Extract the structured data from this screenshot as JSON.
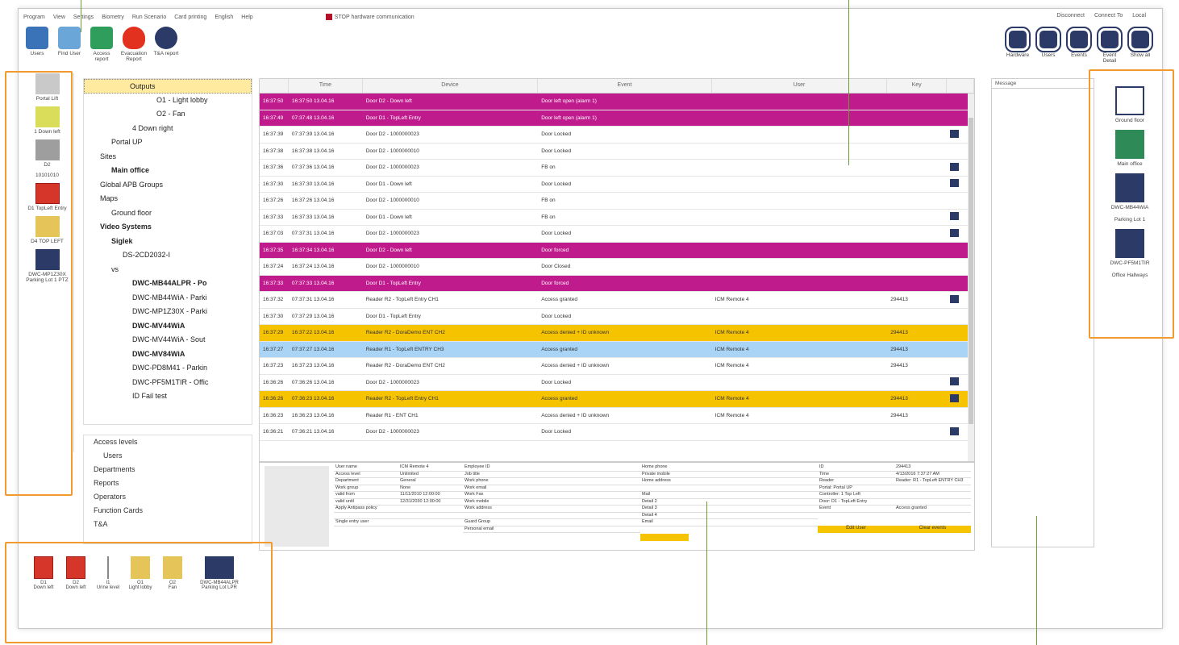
{
  "menu": [
    "Program",
    "View",
    "Settings",
    "Biometry",
    "Run Scenario",
    "Card printing",
    "English",
    "Help"
  ],
  "stop_label": "STOP hardware communication",
  "menu_right": [
    "Disconnect",
    "Connect To",
    "Local"
  ],
  "toolbar": [
    {
      "label": "Users"
    },
    {
      "label": "Find User"
    },
    {
      "label": "Access report"
    },
    {
      "label": "Evacuation Report"
    },
    {
      "label": "T&A report"
    }
  ],
  "toolbar_right": [
    {
      "label": "Hardware"
    },
    {
      "label": "Users"
    },
    {
      "label": "Events"
    },
    {
      "label": "Event Detail"
    },
    {
      "label": "Show all"
    }
  ],
  "left_items": [
    {
      "label": "Portal Lift"
    },
    {
      "label": "1 Down left"
    },
    {
      "label": "D2"
    },
    {
      "label": "10101010"
    },
    {
      "label": "D1 TopLeft Entry"
    },
    {
      "label": "D4 TOP LEFT"
    },
    {
      "label": "DWC-MP1Z30X Parking Lot 1 PTZ"
    }
  ],
  "tree": [
    "Outputs",
    "O1 - Light lobby",
    "O2 - Fan",
    "4 Down right",
    "Portal UP",
    "Sites",
    "Main office",
    "Global APB Groups",
    "Maps",
    "Ground floor",
    "Video Systems",
    "Siglek",
    "DS-2CD2032-I",
    "vs",
    "DWC-MB44ALPR - Po",
    "DWC-MB44WiA - Parki",
    "DWC-MP1Z30X - Parki",
    "DWC-MV44WiA",
    "DWC-MV44WiA - Sout",
    "DWC-MV84WiA",
    "DWC-PD8M41 - Parkin",
    "DWC-PF5M1TIR - Offic",
    "ID Fail test"
  ],
  "tree2": [
    "Access levels",
    "Users",
    "Departments",
    "Reports",
    "Operators",
    "Function Cards",
    "T&A"
  ],
  "grid_headers": [
    "",
    "Time",
    "Device",
    "Event",
    "User",
    "Key",
    ""
  ],
  "rows": [
    {
      "c": "mag",
      "t": "16:37:50",
      "d": "16:37:50 13.04.16",
      "dev": "Door D2 - Down left",
      "ev": "Door left open (alarm 1)",
      "u": "",
      "k": "",
      "cam": false
    },
    {
      "c": "mag",
      "t": "16:37:49",
      "d": "07:37:48 13.04.16",
      "dev": "Door D1 - TopLeft Entry",
      "ev": "Door left open (alarm 1)",
      "u": "",
      "k": "",
      "cam": false
    },
    {
      "c": "",
      "t": "16:37:39",
      "d": "07:37:39 13.04.16",
      "dev": "Door D2 - 1000000023",
      "ev": "Door Locked",
      "u": "",
      "k": "",
      "cam": true
    },
    {
      "c": "",
      "t": "16:37:38",
      "d": "16:37:38 13.04.16",
      "dev": "Door D2 - 1000000010",
      "ev": "Door Locked",
      "u": "",
      "k": "",
      "cam": false
    },
    {
      "c": "",
      "t": "16:37:36",
      "d": "07:37:36 13.04.16",
      "dev": "Door D2 - 1000000023",
      "ev": "FB on",
      "u": "",
      "k": "",
      "cam": true
    },
    {
      "c": "",
      "t": "16:37:30",
      "d": "16:37:30 13.04.16",
      "dev": "Door D1 - Down left",
      "ev": "Door Locked",
      "u": "",
      "k": "",
      "cam": true
    },
    {
      "c": "",
      "t": "16:37:26",
      "d": "16:37:26 13.04.16",
      "dev": "Door D2 - 1000000010",
      "ev": "FB on",
      "u": "",
      "k": "",
      "cam": false
    },
    {
      "c": "",
      "t": "16:37:33",
      "d": "16:37:33 13.04.16",
      "dev": "Door D1 - Down left",
      "ev": "FB on",
      "u": "",
      "k": "",
      "cam": true
    },
    {
      "c": "",
      "t": "16:37:03",
      "d": "07:37:31 13.04.16",
      "dev": "Door D2 - 1000000023",
      "ev": "Door Locked",
      "u": "",
      "k": "",
      "cam": true
    },
    {
      "c": "mag",
      "t": "16:37:35",
      "d": "16:37:34 13.04.16",
      "dev": "Door D2 - Down left",
      "ev": "Door forced",
      "u": "",
      "k": "",
      "cam": false
    },
    {
      "c": "",
      "t": "16:37:24",
      "d": "16:37:24 13.04.16",
      "dev": "Door D2 - 1000000010",
      "ev": "Door Closed",
      "u": "",
      "k": "",
      "cam": false
    },
    {
      "c": "mag",
      "t": "16:37:33",
      "d": "07:37:33 13.04.16",
      "dev": "Door D1 - TopLeft Entry",
      "ev": "Door forced",
      "u": "",
      "k": "",
      "cam": false
    },
    {
      "c": "",
      "t": "16:37:32",
      "d": "07:37:31 13.04.16",
      "dev": "Reader R2 - TopLeft Entry CH1",
      "ev": "Access granted",
      "u": "ICM Remote 4",
      "k": "294413",
      "cam": true
    },
    {
      "c": "",
      "t": "16:37:30",
      "d": "07:37:29 13.04.16",
      "dev": "Door D1 - TopLeft Entry",
      "ev": "Door Locked",
      "u": "",
      "k": "",
      "cam": false
    },
    {
      "c": "yel",
      "t": "16:37:29",
      "d": "16:37:22 13.04.16",
      "dev": "Reader R2 - DoraDemo ENT CH2",
      "ev": "Access denied + ID unknown",
      "u": "ICM Remote 4",
      "k": "294413",
      "cam": false
    },
    {
      "c": "blu",
      "t": "16:37:27",
      "d": "07:37:27 13.04.16",
      "dev": "Reader R1 - TopLeft ENTRY CH3",
      "ev": "Access granted",
      "u": "ICM Remote 4",
      "k": "294413",
      "cam": false
    },
    {
      "c": "",
      "t": "16:37:23",
      "d": "16:37:23 13.04.16",
      "dev": "Reader R2 - DoraDemo ENT CH2",
      "ev": "Access denied + ID unknown",
      "u": "ICM Remote 4",
      "k": "294413",
      "cam": false
    },
    {
      "c": "",
      "t": "16:36:26",
      "d": "07:36:26 13.04.16",
      "dev": "Door D2 - 1000000023",
      "ev": "Door Locked",
      "u": "",
      "k": "",
      "cam": true
    },
    {
      "c": "yel",
      "t": "16:36:26",
      "d": "07:36:23 13.04.16",
      "dev": "Reader R2 - TopLeft Entry CH1",
      "ev": "Access granted",
      "u": "ICM Remote 4",
      "k": "294413",
      "cam": true
    },
    {
      "c": "",
      "t": "16:36:23",
      "d": "16:36:23 13.04.16",
      "dev": "Reader R1 - ENT CH1",
      "ev": "Access denied + ID unknown",
      "u": "ICM Remote 4",
      "k": "294413",
      "cam": false
    },
    {
      "c": "",
      "t": "16:36:21",
      "d": "07:36:21 13.04.16",
      "dev": "Door D2 - 1000000023",
      "ev": "Door Locked",
      "u": "",
      "k": "",
      "cam": true
    }
  ],
  "detail_col1": [
    "User name",
    "Access level",
    "Department",
    "Work group",
    "valid from",
    "valid until",
    "Apply Antipass policy",
    "",
    "Single entry user"
  ],
  "detail_col1v": [
    "ICM Remote 4",
    "Unlimited",
    "General",
    "None",
    "11/11/2010 12:00:00",
    "12/31/2030 12:00:00",
    "",
    "",
    ""
  ],
  "detail_col2": [
    "Employee ID",
    "Job title",
    "Work phone",
    "Work email",
    "Work Fax",
    "Work mobile",
    "Work address",
    "",
    "Guard Group",
    "Personal email"
  ],
  "detail_col3": [
    "Home phone",
    "Private mobile",
    "Home address",
    "",
    "Mail",
    "Detail 2",
    "Detail 3",
    "Detail 4",
    "Email"
  ],
  "detail_col4": [
    "ID",
    "Time",
    "Reader",
    "Portal: Portal UP",
    "Controller: 1 Top Left",
    "Door: D1 - TopLeft Entry",
    "Event"
  ],
  "detail_col4v": [
    "294413",
    "4/13/2016 7:37:27 AM",
    "Reader: R1 - TopLeft ENTRY CH3",
    "",
    "",
    "",
    "Access granted"
  ],
  "detail_buttons": [
    "Edit User",
    "Clear events"
  ],
  "message_header": "Message",
  "right_items": [
    {
      "label": "Ground floor"
    },
    {
      "label": "Main office"
    },
    {
      "label": "DWC-MB44WiA"
    },
    {
      "label": "Parking Lot 1"
    },
    {
      "label": "DWC-PF5M1TIR"
    },
    {
      "label": "Office Hallways"
    }
  ],
  "bottom_items": [
    {
      "top": "D1",
      "label": "Down left"
    },
    {
      "top": "D2",
      "label": "Down left"
    },
    {
      "top": "I1",
      "label": "Urine level"
    },
    {
      "top": "O1",
      "label": "Light lobby"
    },
    {
      "top": "O2",
      "label": "Fan"
    },
    {
      "top": "DWC-MB44ALPR",
      "label": "Parking Lot LPR"
    }
  ],
  "colors": {
    "magenta": "#c01b8d",
    "yellow": "#f6c300",
    "blue": "#a9d4f5",
    "orange": "#f29a2e",
    "navy": "#2b3a67"
  }
}
